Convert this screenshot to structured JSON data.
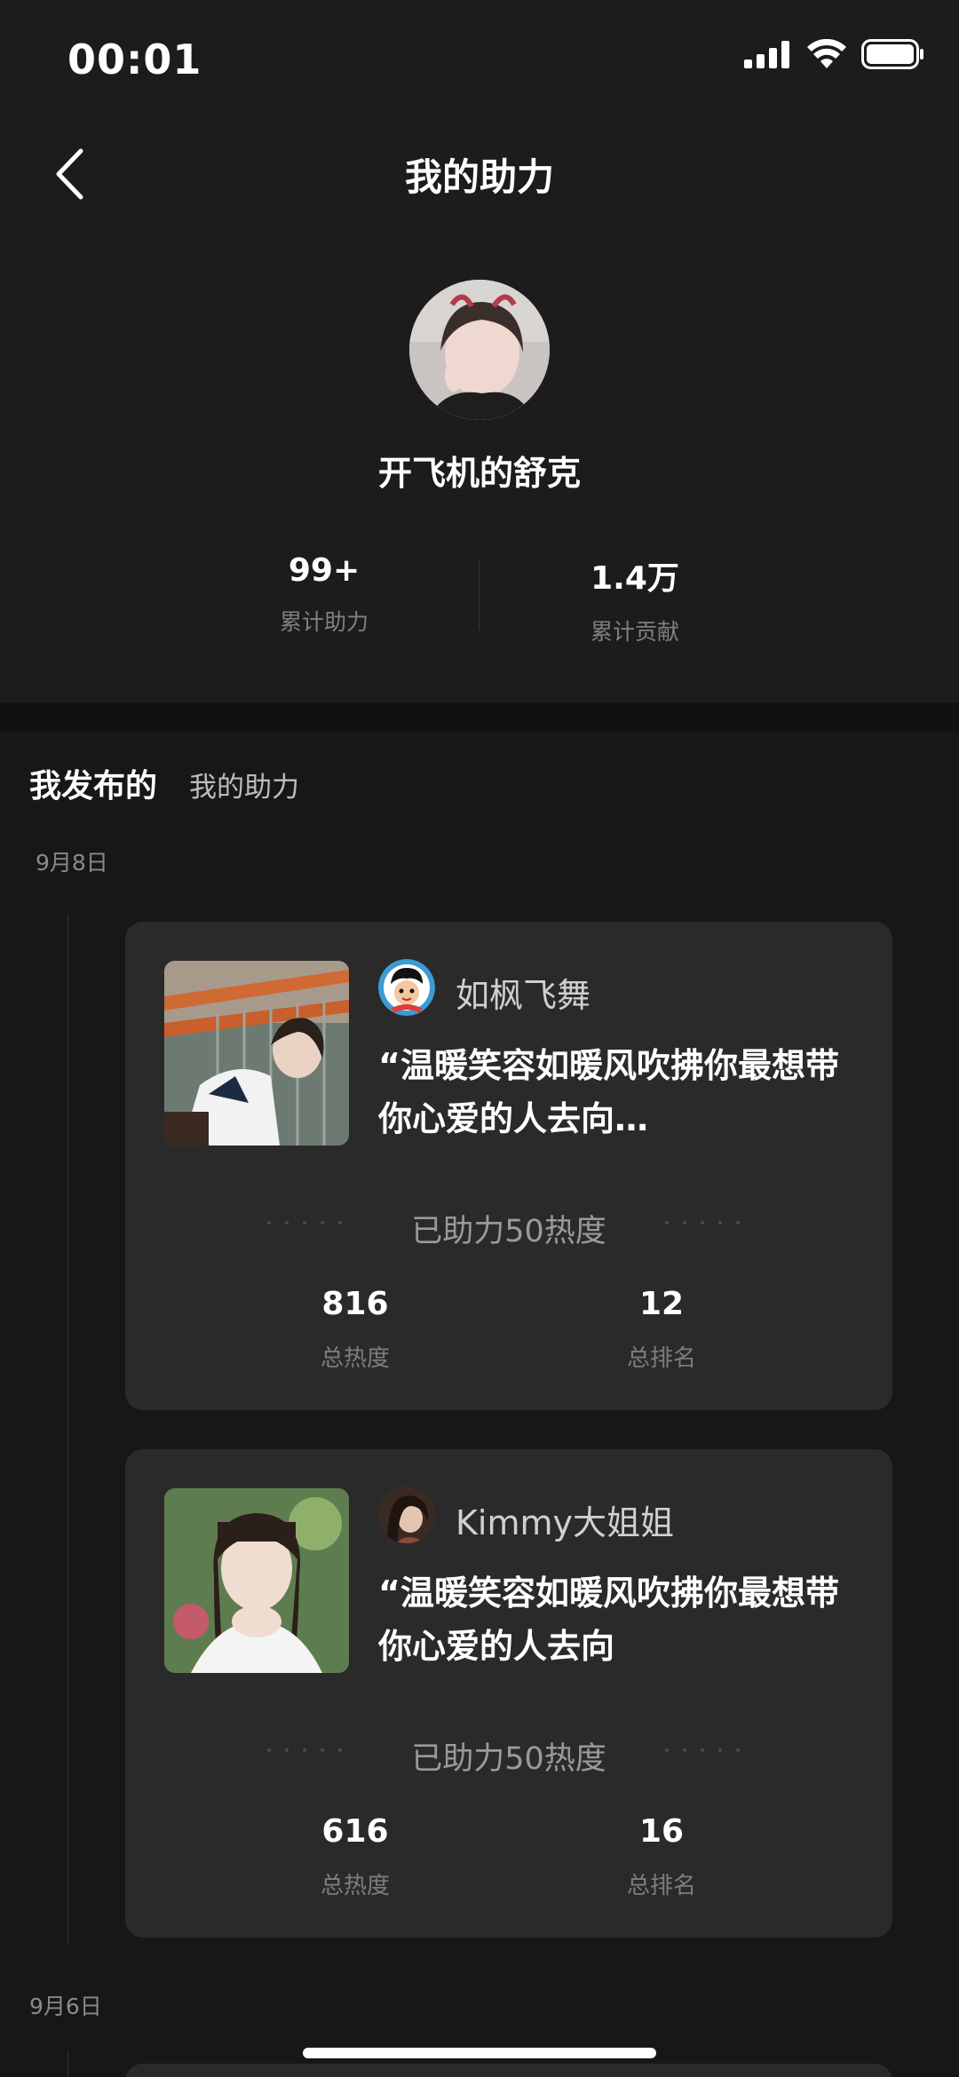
{
  "status_bar": {
    "time": "00:01"
  },
  "header": {
    "title": "我的助力",
    "profile_name": "开飞机的舒克",
    "stats": [
      {
        "value": "99+",
        "label": "累计助力"
      },
      {
        "value": "1.4万",
        "label": "累计贡献"
      }
    ]
  },
  "tabs": [
    "我发布的",
    "我的助力"
  ],
  "dates": [
    "9月8日",
    "9月6日"
  ],
  "cards": [
    {
      "username": "如枫飞舞",
      "quote": "“温暖笑容如暖风吹拂你最想带你心爱的人去向…",
      "helped": "已助力50热度",
      "total_heat_value": "816",
      "total_heat_label": "总热度",
      "total_rank_value": "12",
      "total_rank_label": "总排名"
    },
    {
      "username": "Kimmy大姐姐",
      "quote": "“温暖笑容如暖风吹拂你最想带你心爱的人去向",
      "helped": "已助力50热度",
      "total_heat_value": "616",
      "total_heat_label": "总热度",
      "total_rank_value": "16",
      "total_rank_label": "总排名"
    }
  ],
  "colors": {
    "background": "#171717",
    "header_background": "#1c1c1c",
    "card_background": "#2a2a2a",
    "muted_text": "#808080"
  }
}
